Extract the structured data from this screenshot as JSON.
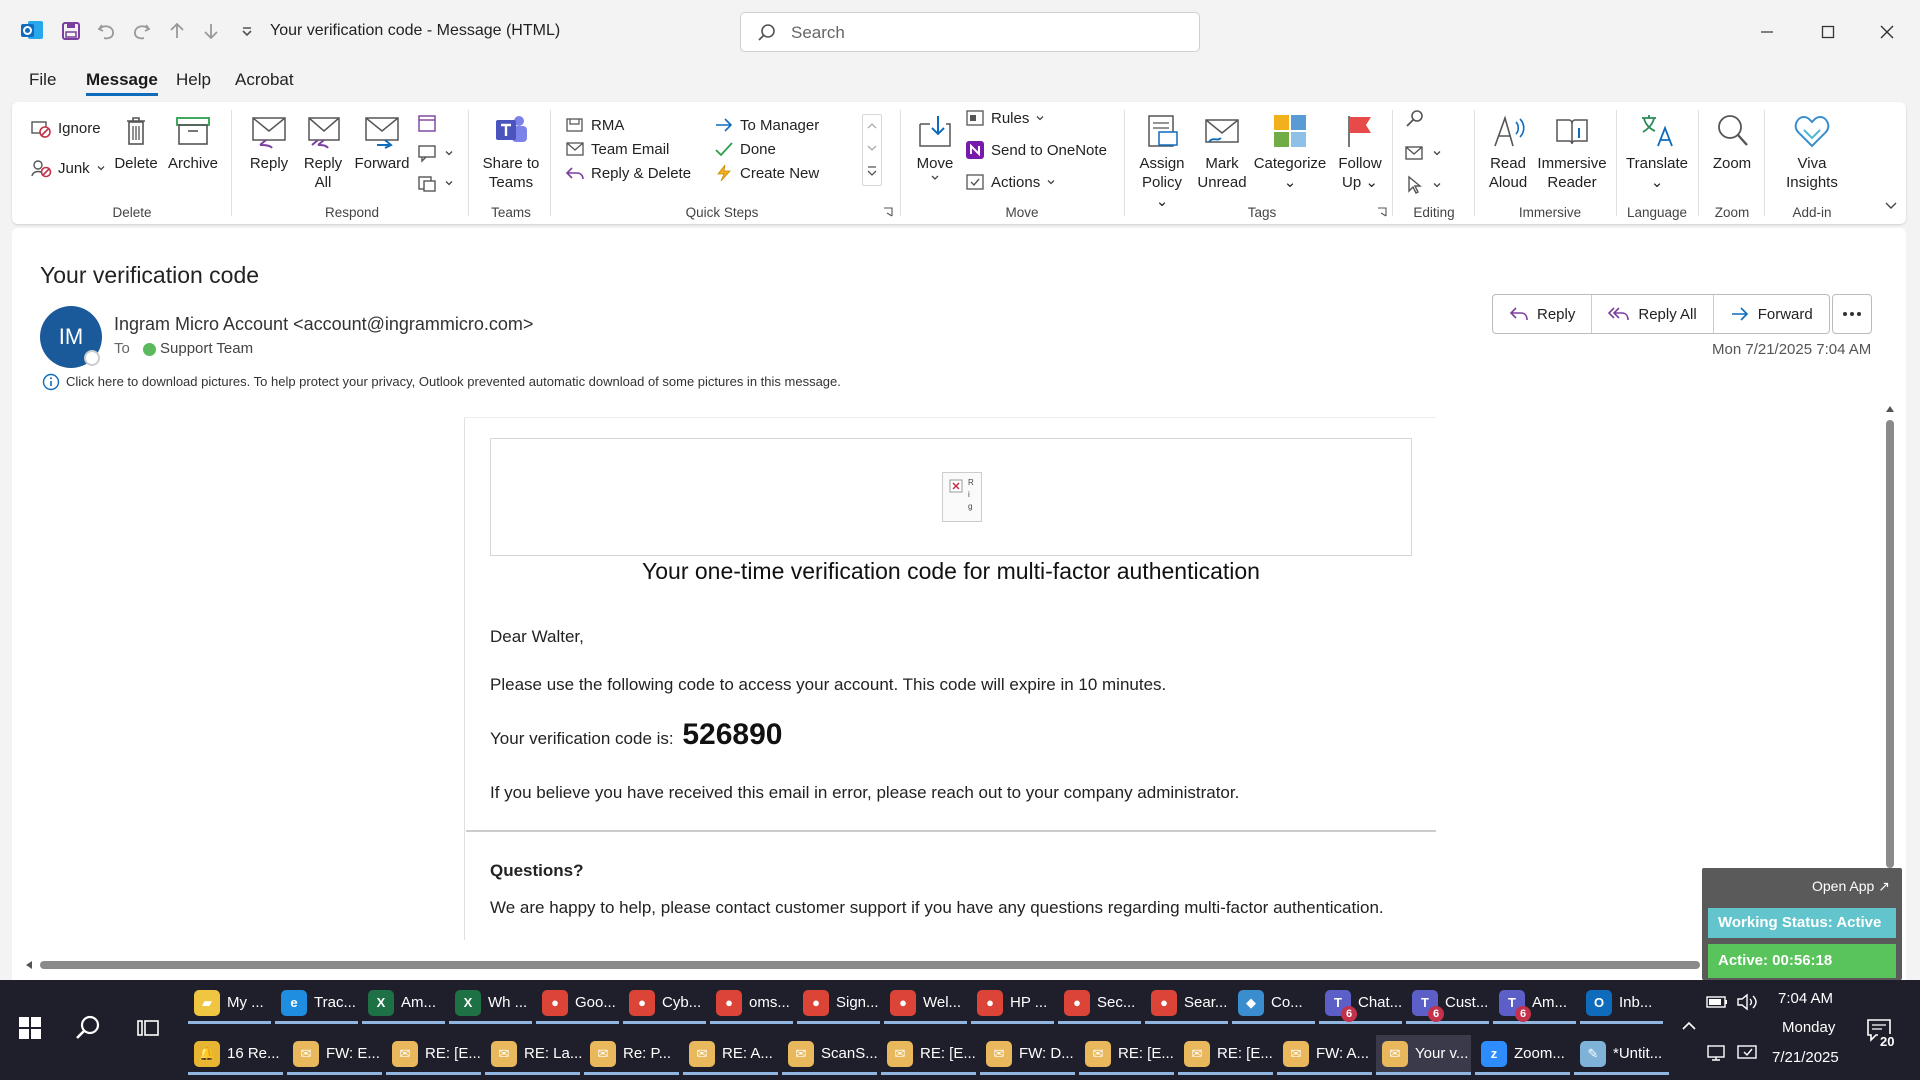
{
  "window": {
    "title": "Your verification code  -  Message (HTML)",
    "search_placeholder": "Search"
  },
  "menu": [
    "File",
    "Message",
    "Help",
    "Acrobat"
  ],
  "ribbon": {
    "delete": {
      "ignore": "Ignore",
      "junk": "Junk",
      "delete": "Delete",
      "archive": "Archive",
      "label": "Delete"
    },
    "respond": {
      "reply": "Reply",
      "reply_all_1": "Reply",
      "reply_all_2": "All",
      "forward": "Forward",
      "label": "Respond"
    },
    "teams": {
      "share_1": "Share to",
      "share_2": "Teams",
      "label": "Teams"
    },
    "quick_steps": {
      "rma": "RMA",
      "team_email": "Team Email",
      "reply_delete": "Reply & Delete",
      "to_manager": "To Manager",
      "done": "Done",
      "create_new": "Create New",
      "label": "Quick Steps"
    },
    "move": {
      "move": "Move",
      "rules": "Rules",
      "onenote": "Send to OneNote",
      "actions": "Actions",
      "label": "Move"
    },
    "tags": {
      "assign_1": "Assign",
      "assign_2": "Policy",
      "mark_1": "Mark",
      "mark_2": "Unread",
      "categorize": "Categorize",
      "follow_1": "Follow",
      "follow_2": "Up",
      "label": "Tags"
    },
    "editing": {
      "label": "Editing"
    },
    "immersive": {
      "read_1": "Read",
      "read_2": "Aloud",
      "reader_1": "Immersive",
      "reader_2": "Reader",
      "label": "Immersive"
    },
    "language": {
      "translate": "Translate",
      "label": "Language"
    },
    "zoom": {
      "zoom": "Zoom",
      "label": "Zoom"
    },
    "addin": {
      "viva_1": "Viva",
      "viva_2": "Insights",
      "label": "Add-in"
    }
  },
  "message": {
    "subject": "Your verification code",
    "avatar": "IM",
    "sender": "Ingram Micro Account <account@ingrammicro.com>",
    "to_label": "To",
    "to_name": "Support Team",
    "date": "Mon 7/21/2025 7:04 AM",
    "info": "Click here to download pictures. To help protect your privacy, Outlook prevented automatic download of some pictures in this message.",
    "actions": {
      "reply": "Reply",
      "reply_all": "Reply All",
      "forward": "Forward"
    },
    "broken_img_text": "R i g"
  },
  "email": {
    "heading": "Your one-time verification code for multi-factor authentication",
    "greeting": "Dear Walter,",
    "line1": "Please use the following code to access your account. This code will expire in 10 minutes.",
    "code_label": "Your verification code is:",
    "code": "526890",
    "line2": "If you believe you have received this email in error, please reach out to your company administrator.",
    "questions": "Questions?",
    "help": "We are happy to help, please contact customer support if you have any questions regarding multi-factor authentication."
  },
  "widget": {
    "open_app": "Open App ↗",
    "status": "Working Status: Active",
    "active": "Active: 00:56:18"
  },
  "taskbar": {
    "row1": [
      {
        "label": "My ...",
        "icon": "folder-icon",
        "color": "#f0c541"
      },
      {
        "label": "Trac...",
        "icon": "edge-icon",
        "color": "#1f8ee0"
      },
      {
        "label": "Am...",
        "icon": "excel-icon",
        "color": "#1e7145"
      },
      {
        "label": "Wh ...",
        "icon": "excel-icon",
        "color": "#1e7145"
      },
      {
        "label": "Goo...",
        "icon": "chrome-icon",
        "color": "#db4437"
      },
      {
        "label": "Cyb...",
        "icon": "chrome-icon",
        "color": "#db4437"
      },
      {
        "label": "oms...",
        "icon": "chrome-icon",
        "color": "#db4437"
      },
      {
        "label": "Sign...",
        "icon": "chrome-icon",
        "color": "#db4437"
      },
      {
        "label": "Wel...",
        "icon": "chrome-icon",
        "color": "#db4437"
      },
      {
        "label": "HP ...",
        "icon": "chrome-icon",
        "color": "#db4437"
      },
      {
        "label": "Sec...",
        "icon": "chrome-icon",
        "color": "#db4437"
      },
      {
        "label": "Sear...",
        "icon": "chrome-icon",
        "color": "#db4437"
      },
      {
        "label": "Co...",
        "icon": "app-icon",
        "color": "#3a8ed0"
      },
      {
        "label": "Chat...",
        "icon": "teams-icon",
        "color": "#5b5fc7",
        "badge": "6"
      },
      {
        "label": "Cust...",
        "icon": "teams-icon",
        "color": "#5b5fc7",
        "badge": "6"
      },
      {
        "label": "Am...",
        "icon": "teams-icon",
        "color": "#5b5fc7",
        "badge": "6"
      },
      {
        "label": "Inb...",
        "icon": "outlook-icon",
        "color": "#0f6cbd"
      }
    ],
    "row2": [
      {
        "label": "16 Re...",
        "icon": "bell-icon",
        "color": "#e8b533"
      },
      {
        "label": "FW: E...",
        "icon": "mail-icon",
        "color": "#e9b85c"
      },
      {
        "label": "RE: [E...",
        "icon": "mail-icon",
        "color": "#e9b85c"
      },
      {
        "label": "RE: La...",
        "icon": "mail-icon",
        "color": "#e9b85c"
      },
      {
        "label": "Re: P...",
        "icon": "mail-icon",
        "color": "#e9b85c"
      },
      {
        "label": "RE: A...",
        "icon": "mail-icon",
        "color": "#e9b85c"
      },
      {
        "label": "ScanS...",
        "icon": "mail-icon",
        "color": "#e9b85c"
      },
      {
        "label": "RE: [E...",
        "icon": "mail-icon",
        "color": "#e9b85c"
      },
      {
        "label": "FW: D...",
        "icon": "mail-icon",
        "color": "#e9b85c"
      },
      {
        "label": "RE: [E...",
        "icon": "mail-icon",
        "color": "#e9b85c"
      },
      {
        "label": "RE: [E...",
        "icon": "mail-icon",
        "color": "#e9b85c"
      },
      {
        "label": "FW: A...",
        "icon": "mail-icon",
        "color": "#e9b85c"
      },
      {
        "label": "Your v...",
        "icon": "mail-icon",
        "color": "#e9b85c",
        "selected": true
      },
      {
        "label": "Zoom...",
        "icon": "zoom-icon",
        "color": "#2d8cff"
      },
      {
        "label": "*Untit...",
        "icon": "notepad-icon",
        "color": "#7fb2d9"
      }
    ],
    "time": "7:04 AM",
    "day": "Monday",
    "date": "7/21/2025",
    "notifications": "20"
  },
  "colors": {
    "accent": "#0f6cbd",
    "avatar": "#1b5a9a",
    "taskbar": "#1f1f2c",
    "widget_status": "#62c4cc",
    "widget_active": "#59c35c"
  }
}
